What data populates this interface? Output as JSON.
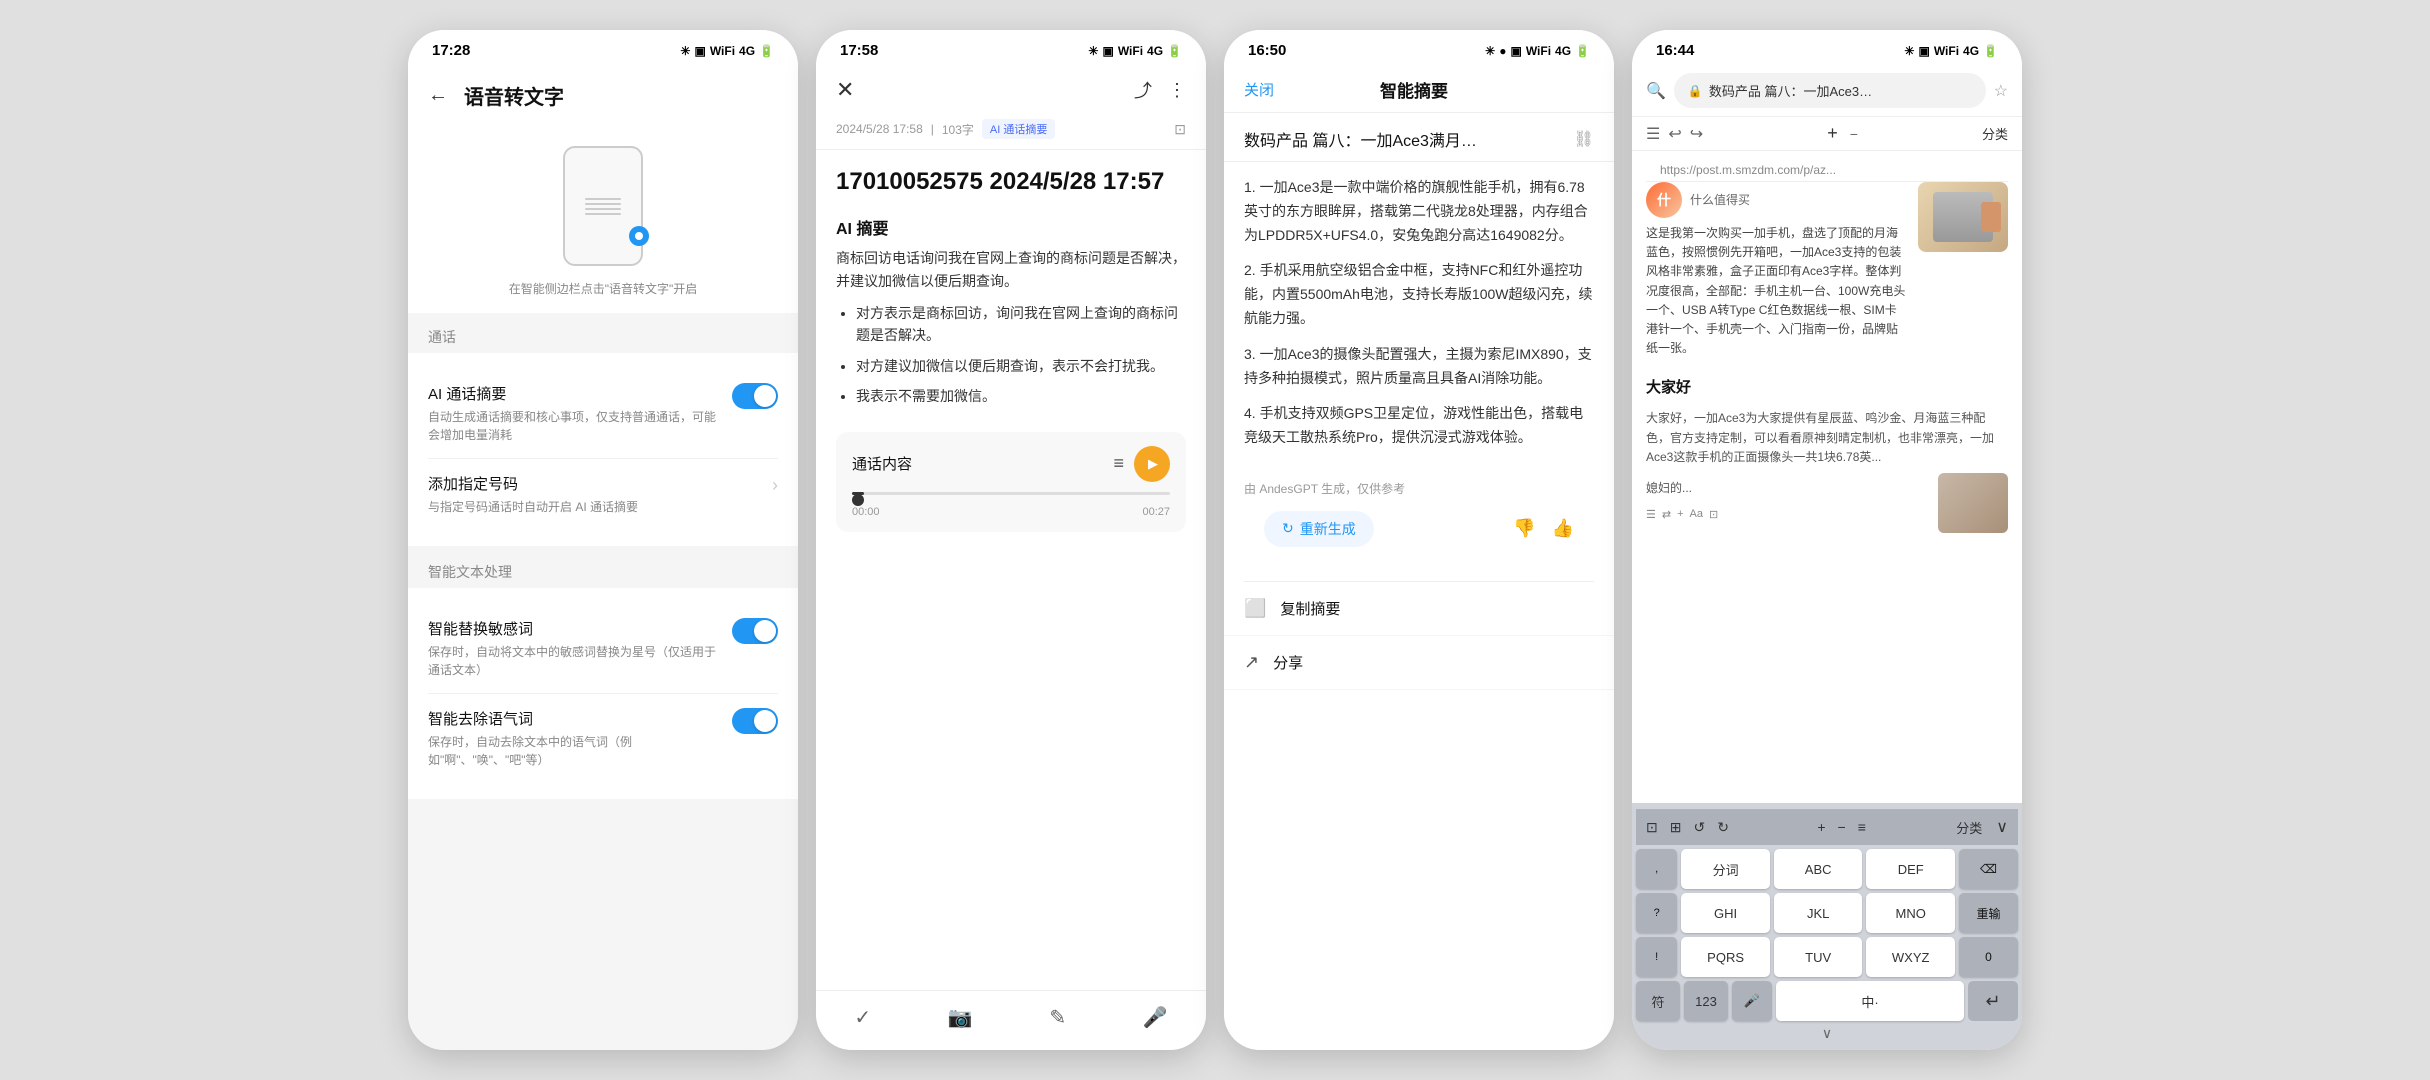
{
  "phone1": {
    "status": {
      "time": "17:28",
      "icons": "✳ ⊟ ≋ ᵢₗ 🔋"
    },
    "header": {
      "back_label": "←",
      "title": "语音转文字"
    },
    "illustration_caption": "在智能侧边栏点击\"语音转文字\"开启",
    "section1_title": "通话",
    "items": [
      {
        "title": "AI 通话摘要",
        "desc": "自动生成通话摘要和核心事项，仅支持普通通话，可能会增加电量消耗",
        "type": "toggle",
        "value": "on"
      },
      {
        "title": "添加指定号码",
        "desc": "与指定号码通话时自动开启 AI 通话摘要",
        "type": "arrow"
      }
    ],
    "section2_title": "智能文本处理",
    "items2": [
      {
        "title": "智能替换敏感词",
        "desc": "保存时，自动将文本中的敏感词替换为星号（仅适用于通话文本）",
        "type": "toggle",
        "value": "on"
      },
      {
        "title": "智能去除语气词",
        "desc": "保存时，自动去除文本中的语气词（例如\"啊\"、\"唤\"、\"吧\"等）",
        "type": "toggle",
        "value": "on"
      }
    ]
  },
  "phone2": {
    "status": {
      "time": "17:58",
      "icons": "✳ ⊟ ≋ ᵢₗ 🔋"
    },
    "meta": {
      "date": "2024/5/28 17:58",
      "chars": "103字",
      "badge": "AI 通话摘要"
    },
    "call_title": "17010052575 2024/5/28 17:57",
    "ai_section_title": "AI 摘要",
    "ai_intro": "商标回访电话询问我在官网上查询的商标问题是否解决，并建议加微信以便后期查询。",
    "bullets": [
      "对方表示是商标回访，询问我在官网上查询的商标问题是否解决。",
      "对方建议加微信以便后期查询，表示不会打扰我。",
      "我表示不需要加微信。"
    ],
    "audio": {
      "section_title": "通话内容",
      "time_current": "00:00",
      "time_total": "00:27"
    },
    "bottom_icons": [
      "✓",
      "📷",
      "✏",
      "🎤"
    ]
  },
  "phone3": {
    "status": {
      "time": "16:50",
      "icons": "✳ ⊟ ≋ ᵢₗ 🔋"
    },
    "header": {
      "close_label": "关闭",
      "title": "智能摘要"
    },
    "article_title": "数码产品 篇八：一加Ace3满月…",
    "summary_items": [
      "1. 一加Ace3是一款中端价格的旗舰性能手机，拥有6.78英寸的东方眼眸屏，搭载第二代骁龙8处理器，内存组合为LPDDR5X+UFS4.0，安兔兔跑分高达1649082分。",
      "2. 手机采用航空级铝合金中框，支持NFC和红外遥控功能，内置5500mAh电池，支持长寿版100W超级闪充，续航能力强。",
      "3. 一加Ace3的摄像头配置强大，主摄为索尼IMX890，支持多种拍摄模式，照片质量高且具备AI消除功能。",
      "4. 手机支持双频GPS卫星定位，游戏性能出色，搭载电竞级天工散热系统Pro，提供沉浸式游戏体验。"
    ],
    "generated_by": "由 AndesGPT 生成，仅供参考",
    "regen_btn": "重新生成",
    "actions": [
      {
        "icon": "⬜",
        "label": "复制摘要"
      },
      {
        "icon": "↗",
        "label": "分享"
      }
    ]
  },
  "phone4": {
    "status": {
      "time": "16:44",
      "icons": "✳ ⊟ ≋ ᵢₗ 🔋"
    },
    "url_bar": {
      "placeholder": "数码产品 篇八：一加Ace3…"
    },
    "article": {
      "avatar_label": "什",
      "meta_text": "什么值得买",
      "title": "数码产品篇八：…",
      "url": "https://post.m.smzdm.com/p/az...",
      "body": "这是我第一次购买一加手机，盘选了顶配的月海蓝色，按照惯例先开箱吧，一加Ace3支持的包装风格非常素雅，盒子正面印有Ace3字样。整体判况度很高，全部配：手机主机一台、100W充电头一个、USB A转Type C红色数据线一根、SIM卡港针一个、手机壳一个、入门指南一份，品牌贴纸一张。",
      "side_image_text": "产品图"
    },
    "section_header": "大家好，一加Ace3为大家提供有星辰蓝、鸣沙金、月海蓝三种配色，官方支持定制，可以看看原神刻晴定制机，也非常漂亮，一加Ace3这款手机的正面摄像头一共1块6.78英...",
    "comment_text": "媳妇的...",
    "keyboard": {
      "toolbar_icons": [
        "⊡",
        "⊞",
        "↺",
        "↻",
        "+",
        "-",
        "≡"
      ],
      "row1": [
        "分词",
        "ABC",
        "DEF",
        "⌫"
      ],
      "row2": [
        "GHI",
        "JKL",
        "MNO",
        "重输"
      ],
      "row3": [
        "PQRS",
        "TUV",
        "WXYZ",
        "0"
      ],
      "row4_left": "符",
      "row4_123": "123",
      "row4_mic": "🎤",
      "row4_cn": "中·",
      "row4_enter": "↵",
      "special_keys": [
        "，",
        "？",
        "！"
      ]
    }
  }
}
